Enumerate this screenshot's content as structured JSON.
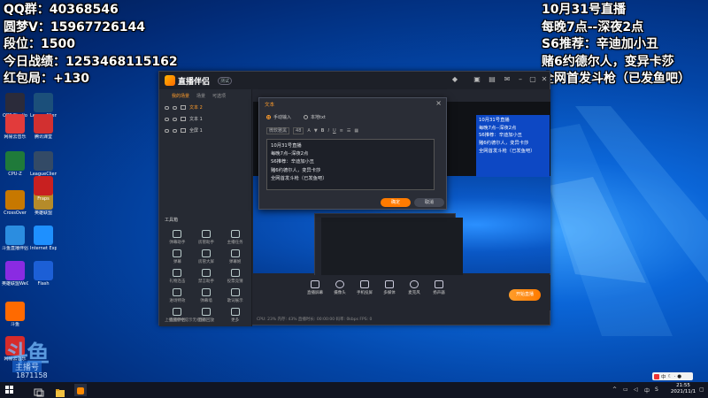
{
  "overlay": {
    "left": [
      "QQ群：40368546",
      "圆梦V：15967726144",
      "段位：1500",
      "今日战绩：1253468115162",
      "红包局：+130"
    ],
    "right": [
      "10月31号直播",
      "每晚7点--深夜2点",
      "S6推荐：辛迪加小丑",
      "赌6约德尔人，变异卡莎",
      "全网首发斗枪（已发鱼吧）"
    ]
  },
  "desktop_icons": [
    {
      "label": "OBS Studio",
      "color": "#2b2b3a"
    },
    {
      "label": "LeagueClient",
      "color": "#1b4f7a"
    },
    {
      "label": "网易云音乐",
      "color": "#e23b3b"
    },
    {
      "label": "腾讯课堂",
      "color": "#d23030"
    },
    {
      "label": "CPU-Z",
      "color": "#1f7a3a"
    },
    {
      "label": "LeagueClient",
      "color": "#334a66"
    },
    {
      "label": "CrossOver",
      "color": "#c77800"
    },
    {
      "label": "英雄联盟",
      "color": "#b58b2a"
    },
    {
      "label": "Fraps",
      "color": "#c82020"
    },
    {
      "label": "斗鱼直播伴侣",
      "color": "#2b8de0"
    },
    {
      "label": "Internet Explorer",
      "color": "#1e90ff"
    },
    {
      "label": "英雄联盟WeGame",
      "color": "#8a2be2"
    },
    {
      "label": "Flash",
      "color": "#1c5fd6"
    },
    {
      "label": "斗鱼",
      "color": "#ff6a00"
    },
    {
      "label": "网易云音乐",
      "color": "#d62b2b"
    }
  ],
  "brand": {
    "logo": "斗鱼",
    "sub": "主播号",
    "num": "1871158"
  },
  "app": {
    "name": "直播伴侣",
    "badge": "测试",
    "tabs": [
      "我的场景",
      "场景",
      "可选项"
    ],
    "layers": [
      "文本 2",
      "文本 1",
      "全屏 1"
    ],
    "tool_title": "工具箱",
    "tools": [
      "弹幕助手",
      "房管助手",
      "主播任务",
      "弹幕",
      "房管大屏",
      "弹幕姬",
      "礼物连击",
      "禁言助手",
      "投票竞猜",
      "进场特效",
      "弹幕墙",
      "歌词展示",
      "直播伴侣",
      "直播回放",
      "更多"
    ],
    "foot": "上播直播中提示无权限",
    "bottom_buttons": [
      "直播屏幕",
      "摄像头",
      "手机投屏",
      "多媒体",
      "麦克风",
      "扬声器"
    ],
    "live_label": "开始直播",
    "status": "CPU: 23%    内存: 43%    直播时长: 00:00:00    码率: 0kbps    FPS: 0"
  },
  "mini_text": [
    "10月31号直播",
    "每晚7点--深夜2点",
    "S6推荐：辛迪加小丑",
    "赌6约德尔人，变异卡莎",
    "全网首发斗枪（已发鱼吧）"
  ],
  "dialog": {
    "title": "文本",
    "radio1": "手动输入",
    "radio2": "本地txt",
    "font": "微软雅黑",
    "size": "48",
    "lines": [
      "10月31号直播",
      "每晚7点--深夜2点",
      "S6推荐：辛迪加小丑",
      "赌6约德尔人，变异卡莎",
      "全网首发斗枪（已发鱼吧）"
    ],
    "ok": "确定",
    "cancel": "取消"
  },
  "taskbar": {
    "time": "21:55",
    "date": "2021/11/1",
    "ime": "中"
  }
}
